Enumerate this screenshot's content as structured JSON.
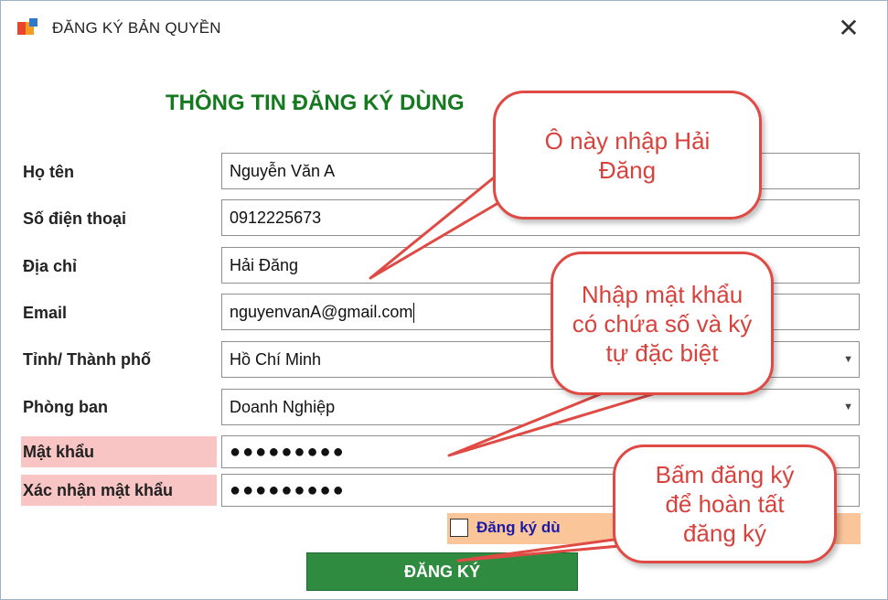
{
  "window": {
    "title": "ĐĂNG KÝ BẢN QUYỀN",
    "close_glyph": "✕",
    "app_icon": "app-logo-icon"
  },
  "form": {
    "heading": "THÔNG TIN ĐĂNG KÝ DÙNG",
    "fields": {
      "name": {
        "label": "Họ tên",
        "value": "Nguyễn Văn A"
      },
      "phone": {
        "label": "Số điện thoại",
        "value": "0912225673"
      },
      "address": {
        "label": "Địa chỉ",
        "value": "Hải Đăng"
      },
      "email": {
        "label": "Email",
        "value": "nguyenvanA@gmail.com"
      },
      "city": {
        "label": "Tỉnh/ Thành phố",
        "value": "Hồ Chí Minh"
      },
      "department": {
        "label": "Phòng ban",
        "value": "Doanh Nghiệp"
      },
      "password": {
        "label": "Mật khẩu",
        "value": "●●●●●●●●●"
      },
      "confirm_password": {
        "label": "Xác nhận mật khẩu",
        "value": "●●●●●●●●●"
      }
    },
    "trial_checkbox_label": "Đăng ký dù",
    "submit_label": "ĐĂNG KÝ"
  },
  "callouts": {
    "address_hint": "Ô này nhập Hải Đăng",
    "password_hint": "Nhập mật khẩu có chứa số và ký tự đặc biệt",
    "submit_hint": "Bấm đăng ký để hoàn tất đăng ký"
  },
  "colors": {
    "heading": "#157a1f",
    "submit_button": "#2e8b40",
    "password_label_bg": "#f8c4c4",
    "trial_area_bg": "#fbc59a",
    "callout_border": "#e04a44",
    "callout_text": "#d8423c"
  }
}
